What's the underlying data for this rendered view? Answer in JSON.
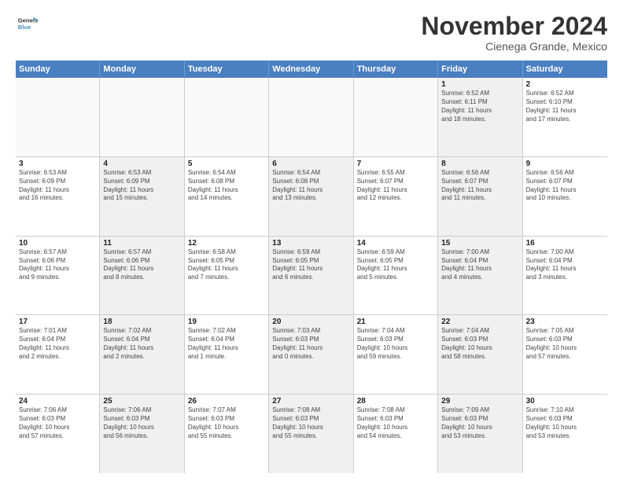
{
  "header": {
    "logo_line1": "General",
    "logo_line2": "Blue",
    "month": "November 2024",
    "location": "Cienega Grande, Mexico"
  },
  "days_of_week": [
    "Sunday",
    "Monday",
    "Tuesday",
    "Wednesday",
    "Thursday",
    "Friday",
    "Saturday"
  ],
  "weeks": [
    [
      {
        "day": "",
        "info": ""
      },
      {
        "day": "",
        "info": ""
      },
      {
        "day": "",
        "info": ""
      },
      {
        "day": "",
        "info": ""
      },
      {
        "day": "",
        "info": ""
      },
      {
        "day": "1",
        "info": "Sunrise: 6:52 AM\nSunset: 6:11 PM\nDaylight: 11 hours\nand 18 minutes."
      },
      {
        "day": "2",
        "info": "Sunrise: 6:52 AM\nSunset: 6:10 PM\nDaylight: 11 hours\nand 17 minutes."
      }
    ],
    [
      {
        "day": "3",
        "info": "Sunrise: 6:53 AM\nSunset: 6:09 PM\nDaylight: 11 hours\nand 16 minutes."
      },
      {
        "day": "4",
        "info": "Sunrise: 6:53 AM\nSunset: 6:09 PM\nDaylight: 11 hours\nand 15 minutes."
      },
      {
        "day": "5",
        "info": "Sunrise: 6:54 AM\nSunset: 6:08 PM\nDaylight: 11 hours\nand 14 minutes."
      },
      {
        "day": "6",
        "info": "Sunrise: 6:54 AM\nSunset: 6:08 PM\nDaylight: 11 hours\nand 13 minutes."
      },
      {
        "day": "7",
        "info": "Sunrise: 6:55 AM\nSunset: 6:07 PM\nDaylight: 11 hours\nand 12 minutes."
      },
      {
        "day": "8",
        "info": "Sunrise: 6:56 AM\nSunset: 6:07 PM\nDaylight: 11 hours\nand 11 minutes."
      },
      {
        "day": "9",
        "info": "Sunrise: 6:56 AM\nSunset: 6:07 PM\nDaylight: 11 hours\nand 10 minutes."
      }
    ],
    [
      {
        "day": "10",
        "info": "Sunrise: 6:57 AM\nSunset: 6:06 PM\nDaylight: 11 hours\nand 9 minutes."
      },
      {
        "day": "11",
        "info": "Sunrise: 6:57 AM\nSunset: 6:06 PM\nDaylight: 11 hours\nand 8 minutes."
      },
      {
        "day": "12",
        "info": "Sunrise: 6:58 AM\nSunset: 6:05 PM\nDaylight: 11 hours\nand 7 minutes."
      },
      {
        "day": "13",
        "info": "Sunrise: 6:59 AM\nSunset: 6:05 PM\nDaylight: 11 hours\nand 6 minutes."
      },
      {
        "day": "14",
        "info": "Sunrise: 6:59 AM\nSunset: 6:05 PM\nDaylight: 11 hours\nand 5 minutes."
      },
      {
        "day": "15",
        "info": "Sunrise: 7:00 AM\nSunset: 6:04 PM\nDaylight: 11 hours\nand 4 minutes."
      },
      {
        "day": "16",
        "info": "Sunrise: 7:00 AM\nSunset: 6:04 PM\nDaylight: 11 hours\nand 3 minutes."
      }
    ],
    [
      {
        "day": "17",
        "info": "Sunrise: 7:01 AM\nSunset: 6:04 PM\nDaylight: 11 hours\nand 2 minutes."
      },
      {
        "day": "18",
        "info": "Sunrise: 7:02 AM\nSunset: 6:04 PM\nDaylight: 11 hours\nand 2 minutes."
      },
      {
        "day": "19",
        "info": "Sunrise: 7:02 AM\nSunset: 6:04 PM\nDaylight: 11 hours\nand 1 minute."
      },
      {
        "day": "20",
        "info": "Sunrise: 7:03 AM\nSunset: 6:03 PM\nDaylight: 11 hours\nand 0 minutes."
      },
      {
        "day": "21",
        "info": "Sunrise: 7:04 AM\nSunset: 6:03 PM\nDaylight: 10 hours\nand 59 minutes."
      },
      {
        "day": "22",
        "info": "Sunrise: 7:04 AM\nSunset: 6:03 PM\nDaylight: 10 hours\nand 58 minutes."
      },
      {
        "day": "23",
        "info": "Sunrise: 7:05 AM\nSunset: 6:03 PM\nDaylight: 10 hours\nand 57 minutes."
      }
    ],
    [
      {
        "day": "24",
        "info": "Sunrise: 7:06 AM\nSunset: 6:03 PM\nDaylight: 10 hours\nand 57 minutes."
      },
      {
        "day": "25",
        "info": "Sunrise: 7:06 AM\nSunset: 6:03 PM\nDaylight: 10 hours\nand 56 minutes."
      },
      {
        "day": "26",
        "info": "Sunrise: 7:07 AM\nSunset: 6:03 PM\nDaylight: 10 hours\nand 55 minutes."
      },
      {
        "day": "27",
        "info": "Sunrise: 7:08 AM\nSunset: 6:03 PM\nDaylight: 10 hours\nand 55 minutes."
      },
      {
        "day": "28",
        "info": "Sunrise: 7:08 AM\nSunset: 6:03 PM\nDaylight: 10 hours\nand 54 minutes."
      },
      {
        "day": "29",
        "info": "Sunrise: 7:09 AM\nSunset: 6:03 PM\nDaylight: 10 hours\nand 53 minutes."
      },
      {
        "day": "30",
        "info": "Sunrise: 7:10 AM\nSunset: 6:03 PM\nDaylight: 10 hours\nand 53 minutes."
      }
    ]
  ]
}
